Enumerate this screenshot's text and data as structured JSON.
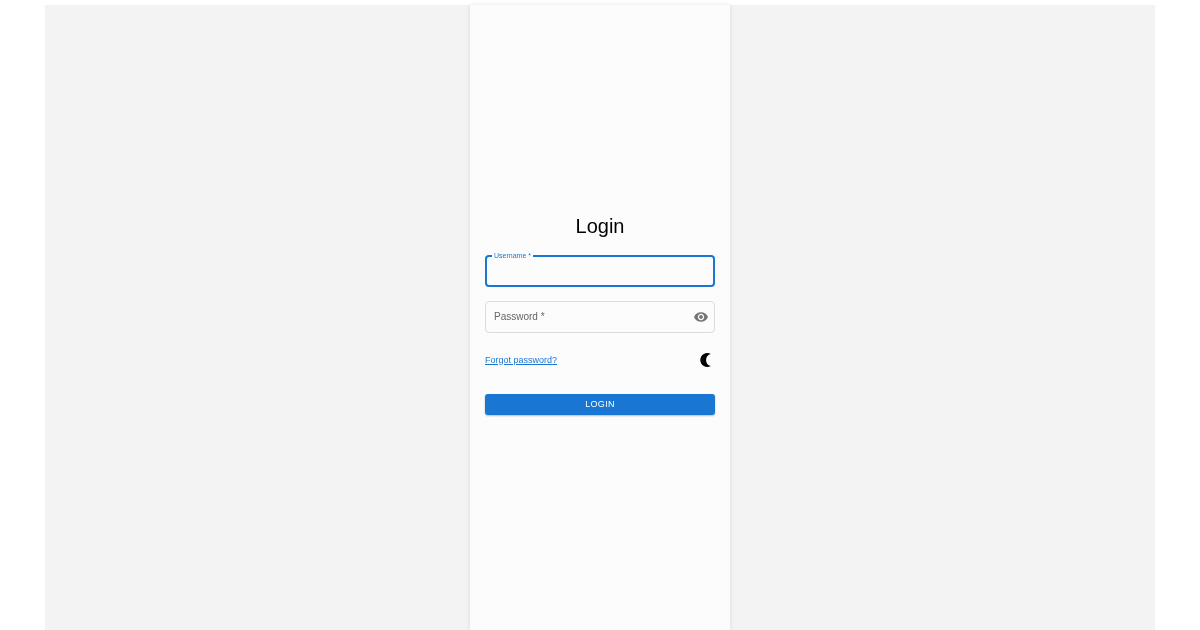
{
  "title": "Login",
  "fields": [
    {
      "kind": "text",
      "label": "Username *",
      "focused": true
    },
    {
      "kind": "password",
      "label": "Password *",
      "focused": false
    }
  ],
  "forgot_link": "Forgot password?",
  "login_button": "LOGIN"
}
